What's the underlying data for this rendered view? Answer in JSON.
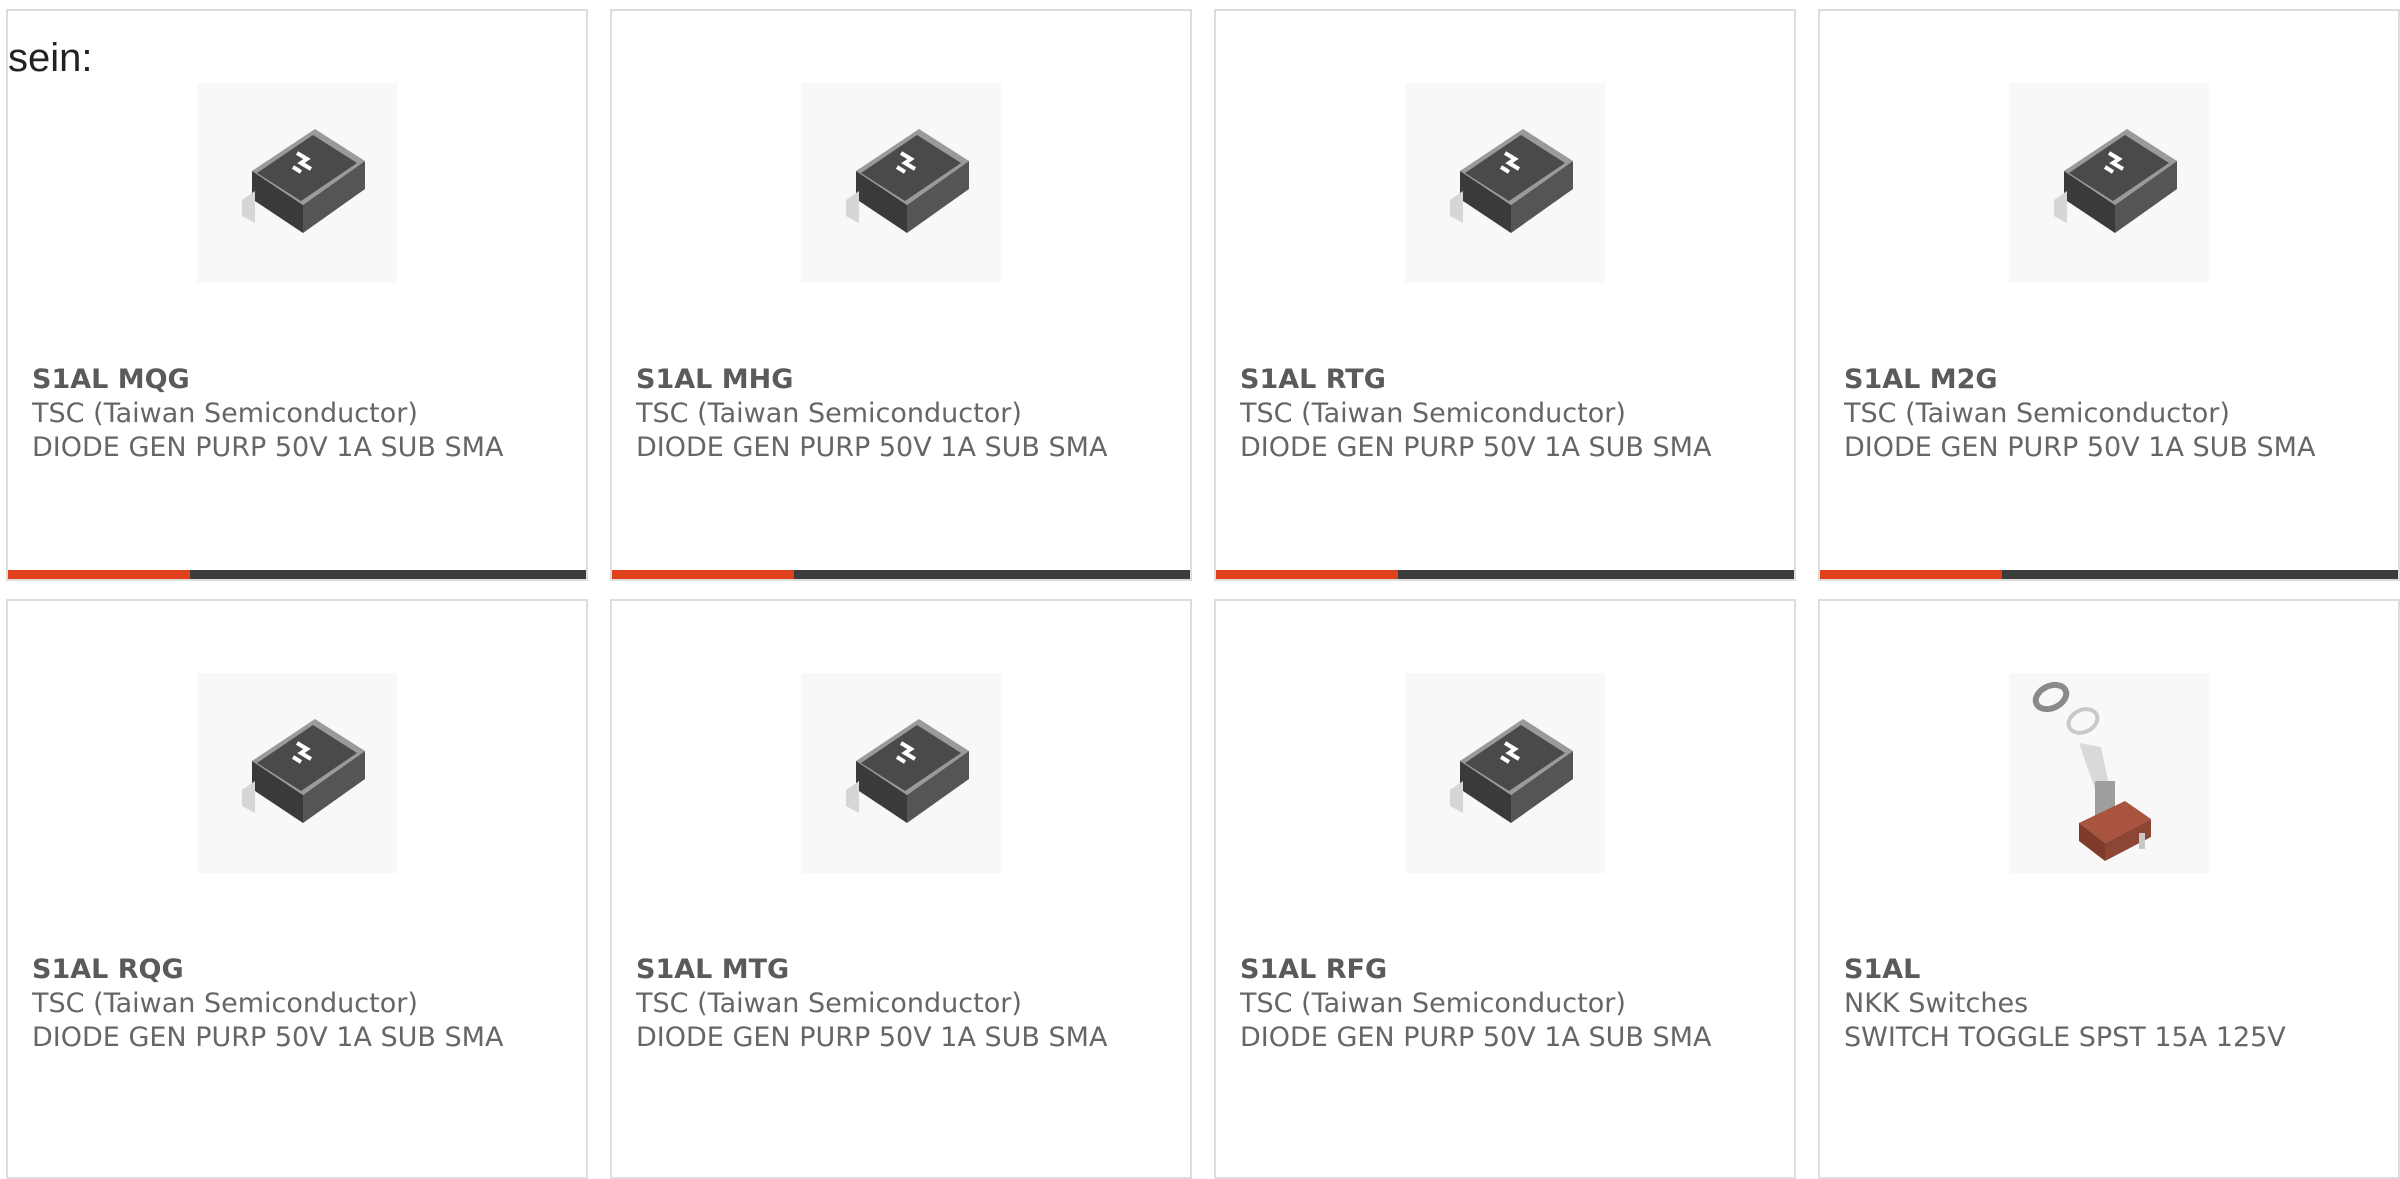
{
  "intro": {
    "text": "sein:"
  },
  "colors": {
    "accent": "#e0401c",
    "bar": "#3c3c3c",
    "border": "#dcdcdc",
    "text": "#666666"
  },
  "products": [
    {
      "part_number": "S1AL MQG",
      "manufacturer": "TSC (Taiwan Semiconductor)",
      "description": "DIODE GEN PURP 50V 1A SUB SMA",
      "image_icon": "sma-diode-icon",
      "has_bar": true
    },
    {
      "part_number": "S1AL MHG",
      "manufacturer": "TSC (Taiwan Semiconductor)",
      "description": "DIODE GEN PURP 50V 1A SUB SMA",
      "image_icon": "sma-diode-icon",
      "has_bar": true
    },
    {
      "part_number": "S1AL RTG",
      "manufacturer": "TSC (Taiwan Semiconductor)",
      "description": "DIODE GEN PURP 50V 1A SUB SMA",
      "image_icon": "sma-diode-icon",
      "has_bar": true
    },
    {
      "part_number": "S1AL M2G",
      "manufacturer": "TSC (Taiwan Semiconductor)",
      "description": "DIODE GEN PURP 50V 1A SUB SMA",
      "image_icon": "sma-diode-icon",
      "has_bar": true
    },
    {
      "part_number": "S1AL RQG",
      "manufacturer": "TSC (Taiwan Semiconductor)",
      "description": "DIODE GEN PURP 50V 1A SUB SMA",
      "image_icon": "sma-diode-icon",
      "has_bar": false
    },
    {
      "part_number": "S1AL MTG",
      "manufacturer": "TSC (Taiwan Semiconductor)",
      "description": "DIODE GEN PURP 50V 1A SUB SMA",
      "image_icon": "sma-diode-icon",
      "has_bar": false
    },
    {
      "part_number": "S1AL RFG",
      "manufacturer": "TSC (Taiwan Semiconductor)",
      "description": "DIODE GEN PURP 50V 1A SUB SMA",
      "image_icon": "sma-diode-icon",
      "has_bar": false
    },
    {
      "part_number": "S1AL",
      "manufacturer": "NKK Switches",
      "description": "SWITCH TOGGLE SPST 15A 125V",
      "image_icon": "toggle-switch-icon",
      "has_bar": false
    }
  ]
}
